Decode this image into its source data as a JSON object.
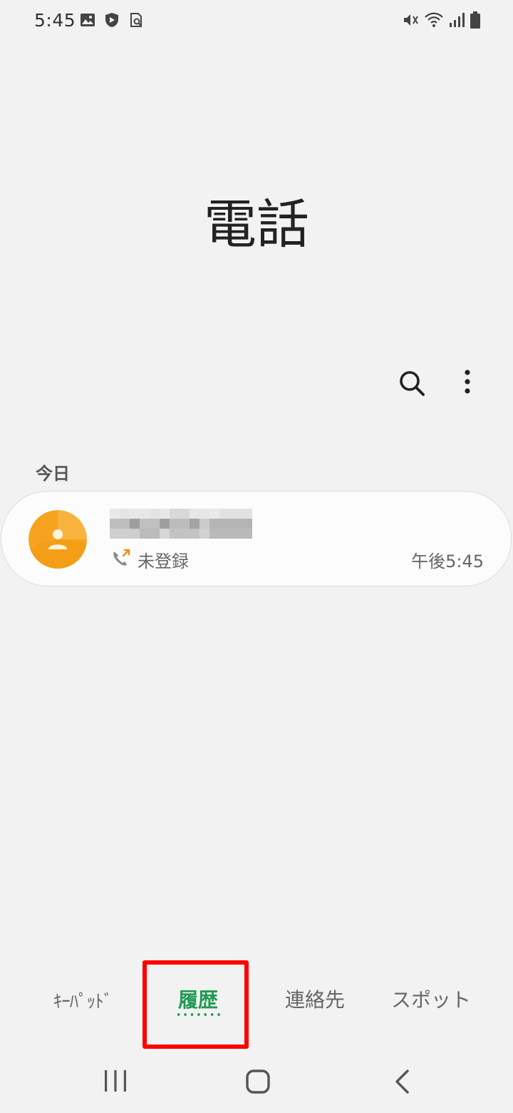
{
  "status_bar": {
    "time": "5:45",
    "left_icons": [
      "image-icon",
      "shield-icon",
      "search-doc-icon"
    ],
    "right_icons": [
      "mute-vibrate-icon",
      "wifi-icon",
      "signal-icon",
      "battery-icon"
    ]
  },
  "header": {
    "title": "電話"
  },
  "toolbar": {
    "icons": [
      "search-icon",
      "more-vert-icon"
    ]
  },
  "call_log": {
    "section_label": "今日",
    "entries": [
      {
        "name_redacted": true,
        "call_type_icon": "outgoing-call-icon",
        "label": "未登録",
        "time": "午後5:45",
        "avatar_color": "#f7a320"
      }
    ]
  },
  "tabs": [
    {
      "label": "ｷｰﾊﾟｯﾄﾞ",
      "selected": false
    },
    {
      "label": "履歴",
      "selected": true
    },
    {
      "label": "連絡先",
      "selected": false
    },
    {
      "label": "スポット",
      "selected": false
    }
  ],
  "nav_bar": {
    "icons": [
      "recents-icon",
      "home-icon",
      "back-icon"
    ]
  },
  "colors": {
    "accent": "#1e9a53",
    "highlight": "#ff0000",
    "background": "#f2f2f2"
  }
}
